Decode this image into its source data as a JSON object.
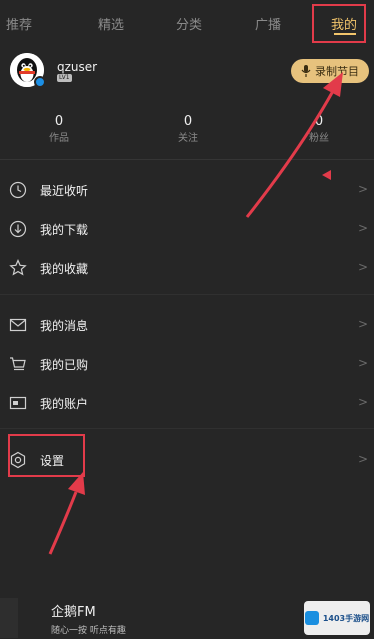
{
  "tabs": [
    {
      "label": "推荐"
    },
    {
      "label": "精选"
    },
    {
      "label": "分类"
    },
    {
      "label": "广播"
    },
    {
      "label": "我的",
      "active": true
    }
  ],
  "profile": {
    "username": "qzuser",
    "level": "LV1",
    "record_button": "录制节目",
    "stats": [
      {
        "value": "0",
        "label": "作品"
      },
      {
        "value": "0",
        "label": "关注"
      },
      {
        "value": "0",
        "label": "粉丝"
      }
    ]
  },
  "menu": {
    "group1": [
      {
        "label": "最近收听",
        "icon": "clock-icon"
      },
      {
        "label": "我的下载",
        "icon": "download-icon"
      },
      {
        "label": "我的收藏",
        "icon": "star-icon"
      }
    ],
    "group2": [
      {
        "label": "我的消息",
        "icon": "envelope-icon"
      },
      {
        "label": "我的已购",
        "icon": "cart-icon"
      },
      {
        "label": "我的账户",
        "icon": "wallet-icon"
      }
    ],
    "settings": {
      "label": "设置",
      "icon": "gear-icon"
    }
  },
  "player": {
    "title": "企鹅FM",
    "subtitle": "随心一按 听点有趣"
  },
  "watermark": {
    "text": "1403手游网"
  },
  "colors": {
    "background": "#262626",
    "accent": "#f1c46b",
    "annotation": "#e23b4a"
  }
}
